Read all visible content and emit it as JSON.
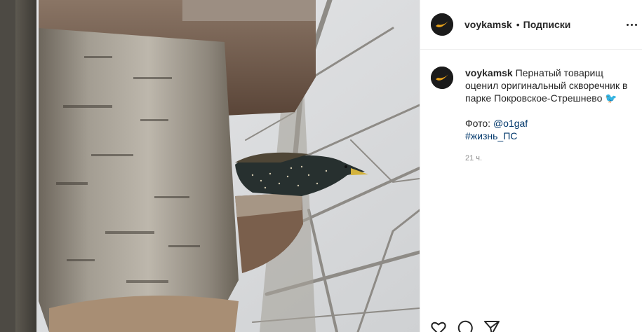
{
  "header": {
    "username": "voykamsk",
    "separator": "•",
    "follow_label": "Подписки"
  },
  "caption": {
    "username": "voykamsk",
    "text": "Пернатый товарищ оценил оригинальный скворечник в парке Покровское-Стрешнево",
    "emoji": "🐦",
    "photo_label": "Фото: ",
    "photo_credit": "@o1gaf",
    "hashtag": "#жизнь_ПС",
    "time": "21 ч."
  },
  "icons": {
    "more": "more-options-icon",
    "like": "heart-icon",
    "comment": "comment-icon",
    "share": "send-icon"
  },
  "colors": {
    "link": "#00376b",
    "muted": "#8e8e8e",
    "avatar_accent": "#e8a21a"
  }
}
